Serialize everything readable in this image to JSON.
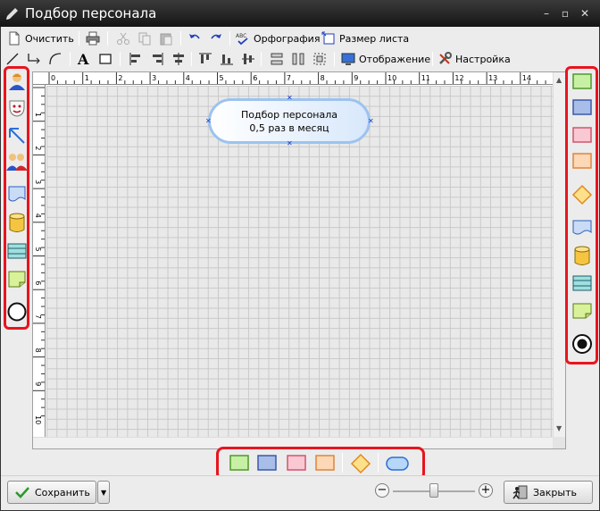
{
  "window": {
    "title": "Подбор персонала"
  },
  "toolbar": {
    "clear_label": "Очистить",
    "spelling_label": "Орфография",
    "page_size_label": "Размер листа",
    "display_label": "Отображение",
    "settings_label": "Настройка"
  },
  "ruler": {
    "top_marks": [
      "0",
      "1",
      "2",
      "3",
      "4",
      "5",
      "6",
      "7",
      "8",
      "9",
      "10",
      "11",
      "12",
      "13",
      "14"
    ],
    "left_marks": [
      "1",
      "2",
      "3",
      "4",
      "5",
      "6",
      "7",
      "8",
      "9",
      "10"
    ]
  },
  "diagram": {
    "shape_line1": "Подбор персонала",
    "shape_line2": "0,5 раз в месяц"
  },
  "footer": {
    "save_label": "Сохранить",
    "close_label": "Закрыть"
  },
  "colors": {
    "highlight": "#e8141e",
    "process_border": "#9cc3ef",
    "titlebar": "#202020"
  },
  "palettes": {
    "left": [
      "person-icon",
      "actor-icon",
      "arrow-icon",
      "group-icon",
      "document-icon",
      "database-icon",
      "table-icon",
      "note-icon",
      "circle-icon"
    ],
    "right": [
      "green-rect-icon",
      "blue-rect-icon",
      "pink-rect-icon",
      "orange-rect-icon",
      "diamond-icon",
      "document-icon",
      "database-icon",
      "table-icon",
      "note-icon",
      "end-circle-icon"
    ],
    "bottom": [
      "green-rect-icon",
      "blue-rect-icon",
      "pink-rect-icon",
      "orange-rect-icon",
      "diamond-icon",
      "rounded-rect-icon"
    ]
  }
}
